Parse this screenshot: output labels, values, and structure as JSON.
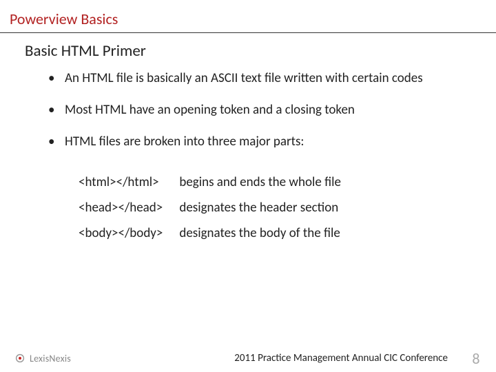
{
  "header": {
    "title": "Powerview Basics"
  },
  "subtitle": "Basic HTML Primer",
  "bullets": [
    "An HTML file is basically an ASCII text file written with certain codes",
    "Most HTML have an opening token and a closing token",
    "HTML files are broken into three major parts:"
  ],
  "tag_table": [
    {
      "tag": "<html></html>",
      "desc": "begins and ends the whole file"
    },
    {
      "tag": "<head></head>",
      "desc": "designates the header section"
    },
    {
      "tag": "<body></body>",
      "desc": "designates the body of the file"
    }
  ],
  "footer": {
    "logo_text": "LexisNexis",
    "conference": "2011 Practice Management Annual CIC Conference",
    "page_number": "8"
  }
}
